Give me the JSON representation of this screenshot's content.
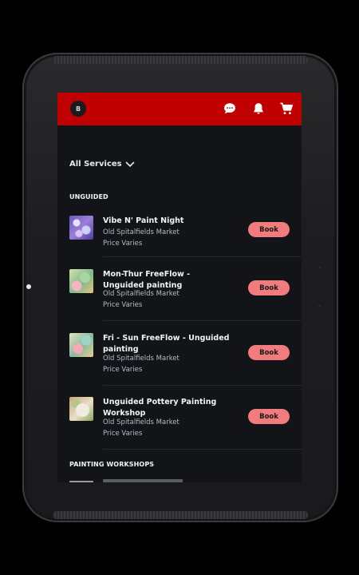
{
  "app": {
    "avatar_initial": "B"
  },
  "header": {
    "icons": [
      "chat-bubble-icon",
      "bell-icon",
      "cart-icon"
    ],
    "bar_color": "#c00000"
  },
  "filter": {
    "label": "All Services"
  },
  "sections": [
    {
      "title": "UNGUIDED",
      "items": [
        {
          "title": "Vibe N' Paint Night",
          "location": "Old Spitalfields Market",
          "price": "Price Varies",
          "button": "Book"
        },
        {
          "title": "Mon-Thur FreeFlow - Unguided painting",
          "location": "Old Spitalfields Market",
          "price": "Price Varies",
          "button": "Book"
        },
        {
          "title": "Fri - Sun FreeFlow - Unguided painting",
          "location": "Old Spitalfields Market",
          "price": "Price Varies",
          "button": "Book"
        },
        {
          "title": "Unguided Pottery Painting Workshop",
          "location": "Old Spitalfields Market",
          "price": "Price Varies",
          "button": "Book"
        }
      ]
    },
    {
      "title": "PAINTING WORKSHOPS",
      "items": []
    }
  ],
  "colors": {
    "accent": "#c00000",
    "book_button": "#f27b7d",
    "background": "#121418"
  }
}
